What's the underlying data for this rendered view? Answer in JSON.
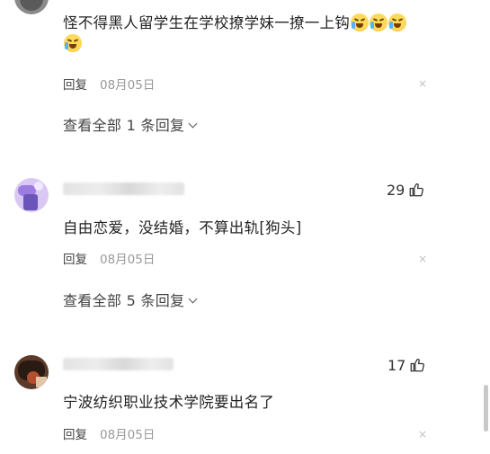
{
  "comments": [
    {
      "text": "怪不得黑人留学生在学校撩学妹一撩一上钩",
      "reply_label": "回复",
      "date": "08月05日",
      "close": "×",
      "view_all": "查看全部 1 条回复",
      "emoji_count": 4
    },
    {
      "text": "自由恋爱，没结婚，不算出轨[狗头]",
      "reply_label": "回复",
      "date": "08月05日",
      "close": "×",
      "view_all": "查看全部 5 条回复",
      "likes": "29"
    },
    {
      "text": "宁波纺织职业技术学院要出名了",
      "reply_label": "回复",
      "date": "08月05日",
      "close": "×",
      "likes": "17"
    }
  ],
  "icons": {
    "emoji": "crying-laughing-emoji-icon",
    "like": "thumbs-up-icon",
    "close": "close-icon",
    "chevron": "chevron-down-icon"
  },
  "colors": {
    "text": "#222222",
    "meta": "#999999",
    "emoji": "#ffd95a"
  }
}
